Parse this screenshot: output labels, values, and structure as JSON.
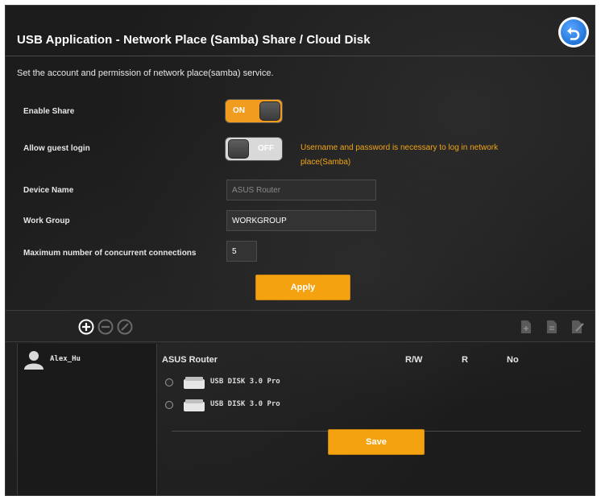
{
  "header": {
    "title": "USB Application - Network Place (Samba) Share / Cloud Disk",
    "back_icon": "back-arrow-icon",
    "subtitle": "Set the account and permission of network place(samba) service."
  },
  "settings": {
    "enable_share": {
      "label": "Enable Share",
      "state": "ON"
    },
    "allow_guest": {
      "label": "Allow guest login",
      "state": "OFF",
      "warning": "Username and password is necessary to log in network place(Samba)"
    },
    "device_name": {
      "label": "Device Name",
      "value": "ASUS Router"
    },
    "work_group": {
      "label": "Work Group",
      "value": "WORKGROUP"
    },
    "max_connections": {
      "label": "Maximum number of concurrent connections",
      "value": "5"
    },
    "apply_label": "Apply"
  },
  "toolbar": {
    "left_icons": [
      "add-circle-icon",
      "remove-circle-icon",
      "edit-circle-icon"
    ],
    "right_icons": [
      "add-folder-icon",
      "folder-icon",
      "edit-folder-icon"
    ]
  },
  "users": [
    {
      "name": "Alex_Hu",
      "icon": "user-icon"
    }
  ],
  "permissions": {
    "device": "ASUS Router",
    "columns": [
      "R/W",
      "R",
      "No"
    ],
    "disks": [
      {
        "name": "USB DISK 3.0 Pro",
        "icon": "drive-icon"
      },
      {
        "name": "USB DISK 3.0 Pro",
        "icon": "drive-icon"
      }
    ],
    "save_label": "Save"
  },
  "colors": {
    "accent": "#f5a211",
    "warning": "#f2a516",
    "background": "#1c1c1c",
    "back_button": "#0a5fc9"
  }
}
